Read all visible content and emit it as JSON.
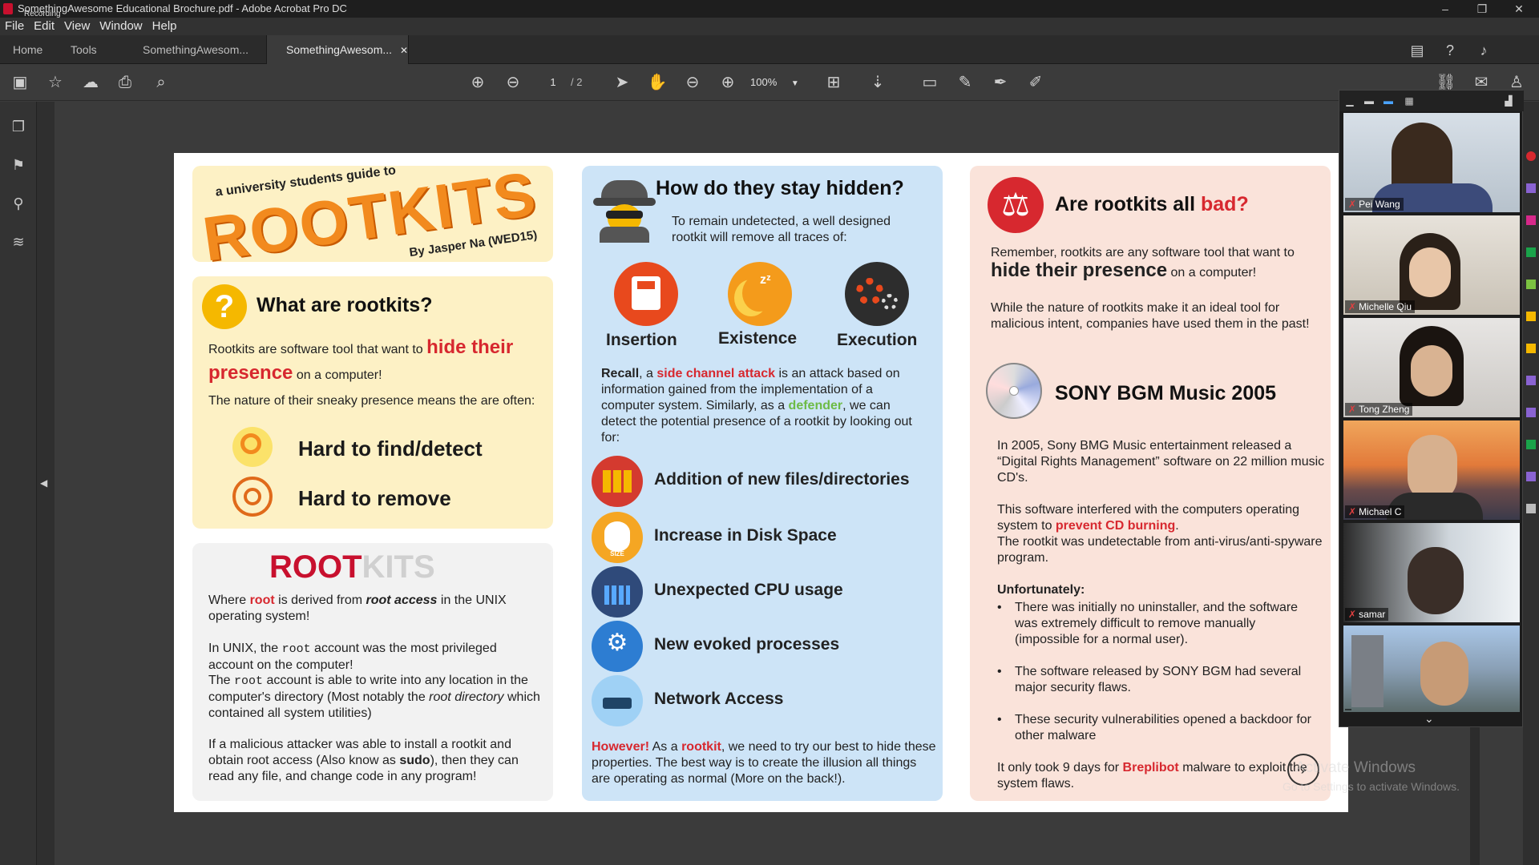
{
  "window": {
    "title": "SomethingAwesome Educational Brochure.pdf - Adobe Acrobat Pro DC",
    "recording": "Recording",
    "min": "–",
    "max": "❐",
    "close": "✕"
  },
  "menu": [
    "File",
    "Edit",
    "View",
    "Window",
    "Help"
  ],
  "tabs": {
    "home": "Home",
    "tools": "Tools",
    "doc1": "SomethingAwesom...",
    "doc2": "SomethingAwesom...",
    "close": "✕"
  },
  "toolbar": {
    "page_current": "1",
    "page_total": "/ 2",
    "zoom": "100%"
  },
  "brochure": {
    "header": {
      "subtitle": "a university students guide to",
      "title": "ROOTKITS",
      "author": "By Jasper Na (WED15)"
    },
    "what": {
      "title": "What are rootkits?",
      "p1_pre": "Rootkits are software tool that want to ",
      "p1_red": "hide their presence",
      "p1_post": " on a computer!",
      "p2": "The nature of their sneaky presence means the are often:",
      "item1": "Hard to find/detect",
      "item2": "Hard to remove"
    },
    "root": {
      "title_a": "ROOT",
      "title_b": "KITS",
      "p1_a": "Where ",
      "p1_b": "root",
      "p1_c": " is derived from ",
      "p1_d": "root access",
      "p1_e": " in the UNIX operating system!",
      "p2_a": "In UNIX, the ",
      "p2_b": "root",
      "p2_c": " account was the most privileged account on the computer!",
      "p3_a": "The ",
      "p3_b": "root",
      "p3_c": " account is able to write into any location in the computer's directory (Most notably the ",
      "p3_d": "root directory",
      "p3_e": " which contained all system utilities)",
      "p4_a": "If a malicious attacker was able to install a rootkit and obtain root access (Also know as ",
      "p4_b": "sudo",
      "p4_c": "), then they can read any file, and change code in any program!"
    },
    "hidden": {
      "title": "How do they stay hidden?",
      "intro": "To remain undetected, a well designed rootkit will remove all traces of:",
      "i1": "Insertion",
      "i2": "Existence",
      "i3": "Execution",
      "recall_a": "Recall",
      "recall_b": ", a ",
      "recall_c": "side channel attack",
      "recall_d": " is an attack based on information gained from the implementation of a computer system. Similarly, as a ",
      "recall_e": "defender",
      "recall_f": ", we can detect the potential presence of a rootkit by looking out for:",
      "l1": "Addition of new files/directories",
      "l2": "Increase in Disk Space",
      "l3": "Unexpected CPU usage",
      "l4": "New evoked processes",
      "l5": "Network Access",
      "disk_size": "SIZE",
      "however_a": "However!",
      "however_b": " As a ",
      "however_c": "rootkit",
      "however_d": ", we need to try our best to hide these properties. The best way is to create the illusion all things are operating as normal (More on the back!)."
    },
    "bad": {
      "title_a": "Are rootkits all ",
      "title_b": "bad?",
      "p1_a": "Remember, rootkits are any software tool that want to ",
      "p1_b": "hide their presence",
      "p1_c": " on a computer!",
      "p2": "While the nature of rootkits make it an ideal tool for malicious intent, companies have used them in the past!",
      "sony_title": "SONY BGM Music 2005",
      "p3": "In 2005, Sony BMG Music entertainment released a “Digital Rights Management” software on 22 million music CD's.",
      "p4_a": "This software interfered with the computers operating system to ",
      "p4_b": "prevent CD burning",
      "p4_c": ".",
      "p5": "The rootkit was undetectable from anti-virus/anti-spyware program.",
      "unf": "Unfortunately:",
      "b1": "There was initially no uninstaller, and the software was extremely difficult to remove manually (impossible for a normal user).",
      "b2": "The software released by SONY BGM had several major security flaws.",
      "b3": "These security vulnerabilities opened a backdoor for other malware",
      "p6_a": "It only took 9 days for ",
      "p6_b": "Breplibot",
      "p6_c": " malware to exploit the system flaws."
    }
  },
  "participants": [
    {
      "name": "Pei Wang"
    },
    {
      "name": "Michelle Qiu"
    },
    {
      "name": "Tong Zheng"
    },
    {
      "name": "Michael C"
    },
    {
      "name": "samar"
    },
    {
      "name": ""
    }
  ],
  "watermark": {
    "line1": "Activate Windows",
    "line2": "Go to Settings to activate Windows."
  },
  "colors": {
    "accent_red": "#d7282f",
    "acrobat_blue": "#4aa3ff",
    "rootkits_orange": "#f28a1e"
  }
}
